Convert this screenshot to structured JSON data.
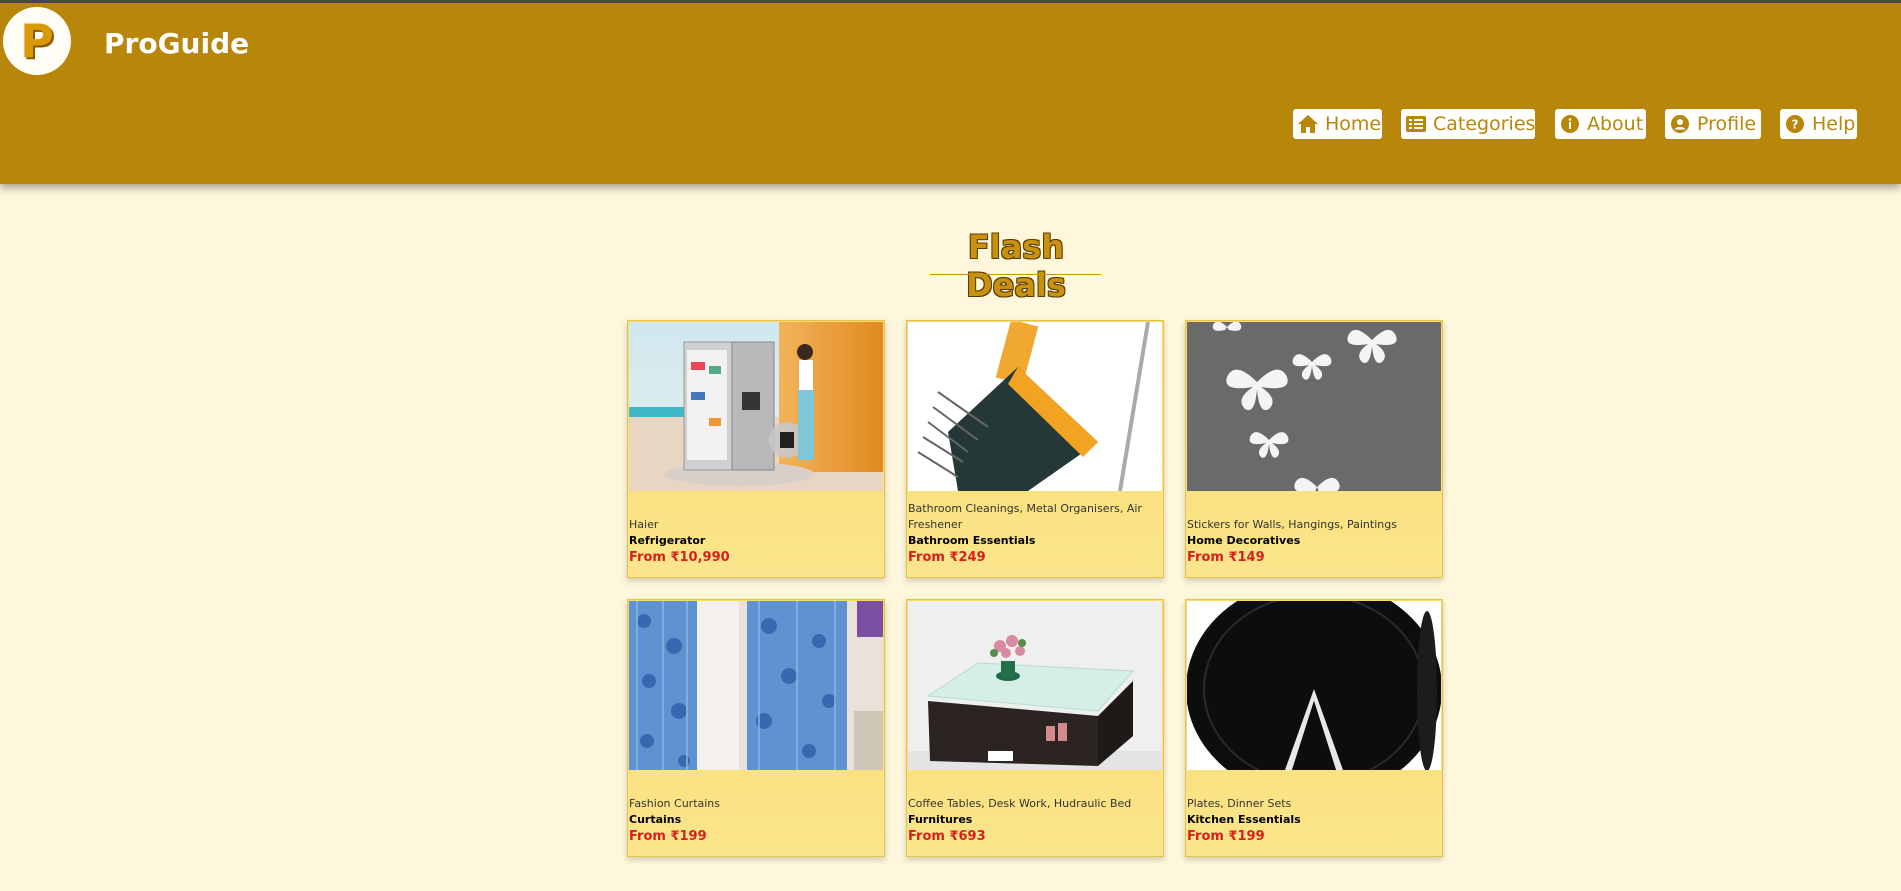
{
  "app": {
    "brand": "ProGuide",
    "logo_letter": "P"
  },
  "colors": {
    "header": "#b8860b",
    "background": "#fef7dc",
    "card": "#f7dc6a",
    "price": "#d81f1f"
  },
  "nav": {
    "items": [
      {
        "label": "Home",
        "icon": "home-icon"
      },
      {
        "label": "Categories",
        "icon": "list-icon"
      },
      {
        "label": "About",
        "icon": "info-icon"
      },
      {
        "label": "Profile",
        "icon": "user-circle-icon"
      },
      {
        "label": "Help",
        "icon": "question-icon"
      }
    ]
  },
  "main": {
    "title": "Flash Deals",
    "deals": [
      {
        "sub": "Haier",
        "name": "Refrigerator",
        "price": "From ₹10,990",
        "image": "refrigerator-image"
      },
      {
        "sub": "Bathroom Cleanings, Metal Organisers, Air Freshener",
        "name": "Bathroom Essentials",
        "price": "From ₹249",
        "image": "floor-wiper-image"
      },
      {
        "sub": "Stickers for Walls, Hangings, Paintings",
        "name": "Home Decoratives",
        "price": "From ₹149",
        "image": "butterfly-wall-sticker-image"
      },
      {
        "sub": "Fashion Curtains",
        "name": "Curtains",
        "price": "From ₹199",
        "image": "blue-curtains-image"
      },
      {
        "sub": "Coffee Tables, Desk Work, Hudraulic Bed",
        "name": "Furnitures",
        "price": "From ₹693",
        "image": "coffee-table-image"
      },
      {
        "sub": "Plates, Dinner Sets",
        "name": "Kitchen Essentials",
        "price": "From ₹199",
        "image": "black-plates-image"
      }
    ]
  }
}
